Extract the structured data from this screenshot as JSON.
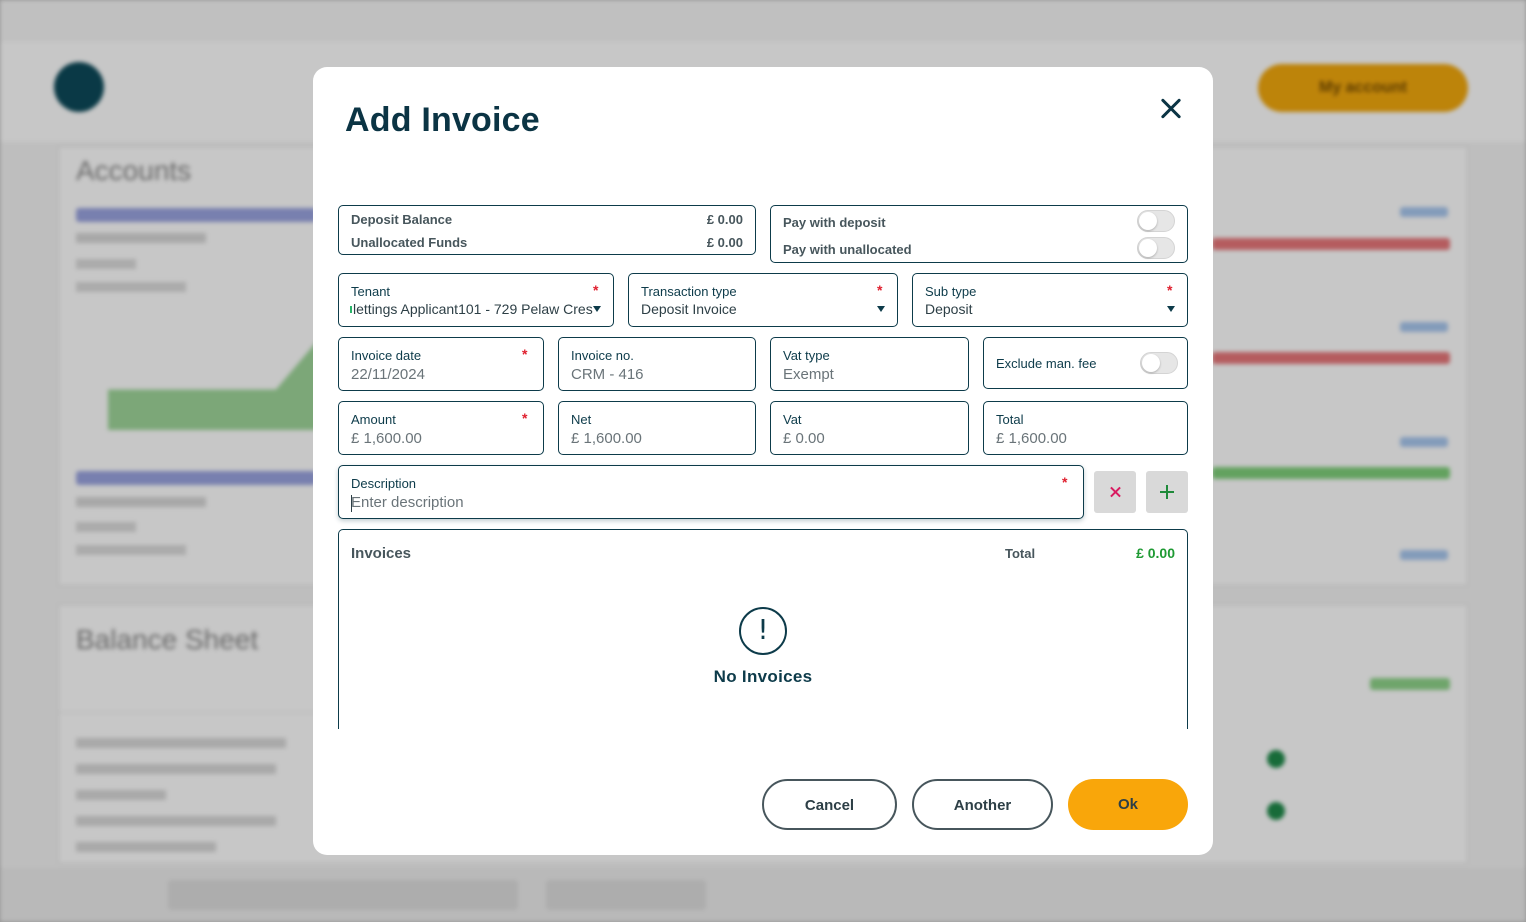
{
  "modal": {
    "title": "Add Invoice",
    "balances": {
      "deposit_balance_label": "Deposit Balance",
      "deposit_balance_value": "£ 0.00",
      "unallocated_funds_label": "Unallocated Funds",
      "unallocated_funds_value": "£ 0.00"
    },
    "pay_options": {
      "pay_with_deposit_label": "Pay with deposit",
      "pay_with_deposit_on": false,
      "pay_with_unallocated_label": "Pay with unallocated",
      "pay_with_unallocated_on": false
    },
    "tenant": {
      "label": "Tenant",
      "value": "lettings Applicant101 - 729 Pelaw Cres"
    },
    "transaction_type": {
      "label": "Transaction type",
      "value": "Deposit Invoice"
    },
    "sub_type": {
      "label": "Sub type",
      "value": "Deposit"
    },
    "invoice_date": {
      "label": "Invoice date",
      "value": "22/11/2024"
    },
    "invoice_no": {
      "label": "Invoice no.",
      "value": "CRM - 416"
    },
    "vat_type": {
      "label": "Vat type",
      "value": "Exempt"
    },
    "exclude_man_fee": {
      "label": "Exclude man. fee",
      "on": false
    },
    "amount": {
      "label": "Amount",
      "value": "£ 1,600.00"
    },
    "net": {
      "label": "Net",
      "value": "£ 1,600.00"
    },
    "vat": {
      "label": "Vat",
      "value": "£ 0.00"
    },
    "total": {
      "label": "Total",
      "value": "£ 1,600.00"
    },
    "description": {
      "label": "Description",
      "value": "",
      "placeholder": "Enter description"
    },
    "required_mark": "*",
    "invoices": {
      "title": "Invoices",
      "total_label": "Total",
      "total_value": "£ 0.00",
      "empty_icon": "!",
      "empty_text": "No Invoices"
    },
    "buttons": {
      "cancel": "Cancel",
      "another": "Another",
      "ok": "Ok"
    }
  },
  "background": {
    "page_heading": "Accounts",
    "balance_heading": "Balance Sheet",
    "my_account": "My account"
  },
  "colors": {
    "primary_dark": "#0d3b4a",
    "accent_orange": "#f9a60a",
    "required_red": "#e0202f",
    "total_green": "#1e9a33"
  }
}
